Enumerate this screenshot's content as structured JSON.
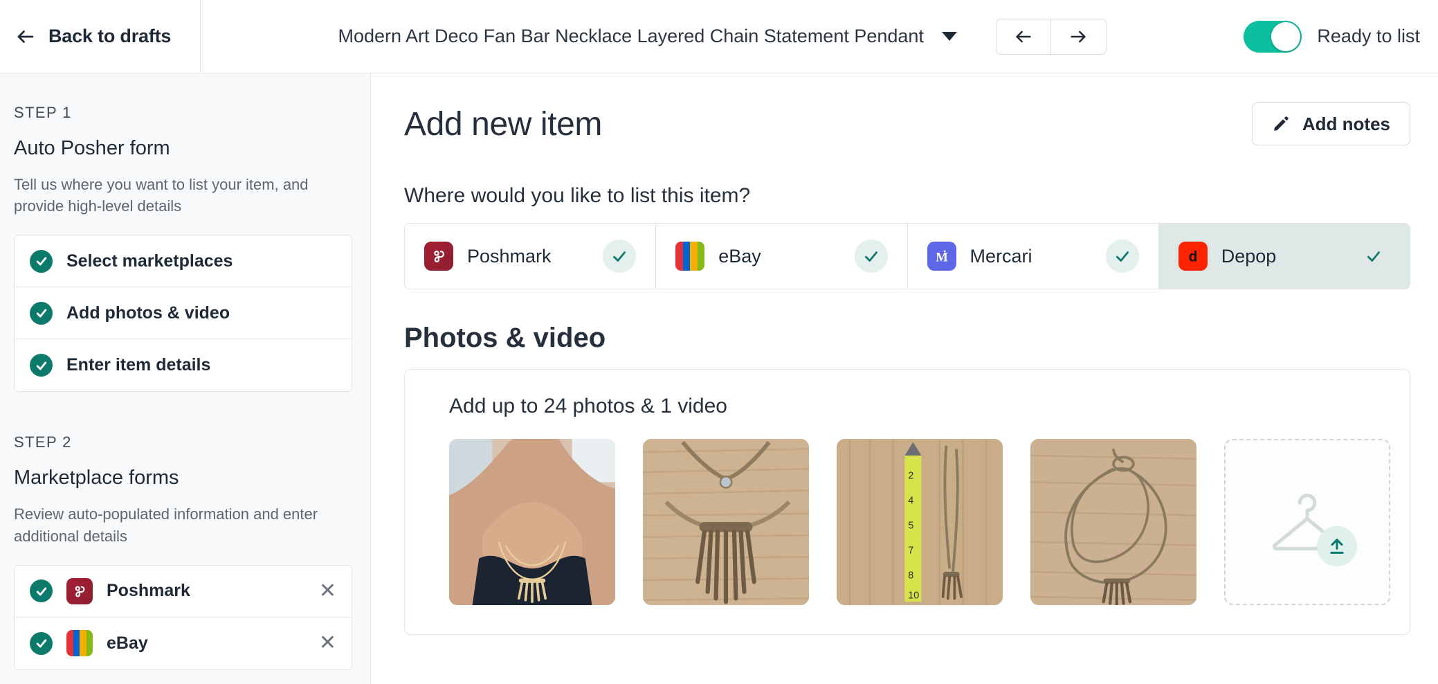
{
  "header": {
    "back_label": "Back to drafts",
    "item_title": "Modern Art Deco Fan Bar Necklace Layered Chain Statement Pendant",
    "prev_icon": "arrow-left-icon",
    "next_icon": "arrow-right-icon",
    "dropdown_icon": "chevron-down-icon",
    "ready_toggle_label": "Ready to list",
    "ready_toggle_on": true,
    "accent_color": "#0bbf9e"
  },
  "sidebar": {
    "step1": {
      "kicker": "STEP 1",
      "title": "Auto Posher form",
      "description": "Tell us where you want to list your item, and provide high-level details",
      "items": [
        {
          "label": "Select marketplaces",
          "status": "complete"
        },
        {
          "label": "Add photos & video",
          "status": "complete"
        },
        {
          "label": "Enter item details",
          "status": "complete"
        }
      ]
    },
    "step2": {
      "kicker": "STEP 2",
      "title": "Marketplace forms",
      "description": "Review auto-populated information and enter additional details",
      "items": [
        {
          "label": "Poshmark",
          "status": "complete",
          "logo": "poshmark-logo",
          "remove_icon": "close-icon"
        },
        {
          "label": "eBay",
          "status": "complete",
          "logo": "ebay-logo",
          "remove_icon": "close-icon"
        }
      ]
    },
    "check_color": "#0b7a6a"
  },
  "main": {
    "page_title": "Add new item",
    "add_notes_label": "Add notes",
    "add_notes_icon": "pencil-icon",
    "marketplace_question": "Where would you like to list this item?",
    "marketplaces": [
      {
        "name": "Poshmark",
        "logo": "poshmark-logo",
        "selected": true,
        "active": false
      },
      {
        "name": "eBay",
        "logo": "ebay-logo",
        "selected": true,
        "active": false
      },
      {
        "name": "Mercari",
        "logo": "mercari-logo",
        "selected": true,
        "active": false
      },
      {
        "name": "Depop",
        "logo": "depop-logo",
        "selected": true,
        "active": true
      }
    ],
    "photos": {
      "section_title": "Photos & video",
      "subtitle": "Add up to 24 photos & 1 video",
      "max_photos": 24,
      "max_videos": 1,
      "thumbnails": [
        {
          "alt": "necklace worn on model"
        },
        {
          "alt": "close-up of fan bar pendant on wood"
        },
        {
          "alt": "necklace with tape measure on wood"
        },
        {
          "alt": "full necklace laid flat on wood"
        }
      ],
      "upload_slot": {
        "icon": "hanger-upload-icon",
        "label": ""
      }
    }
  }
}
